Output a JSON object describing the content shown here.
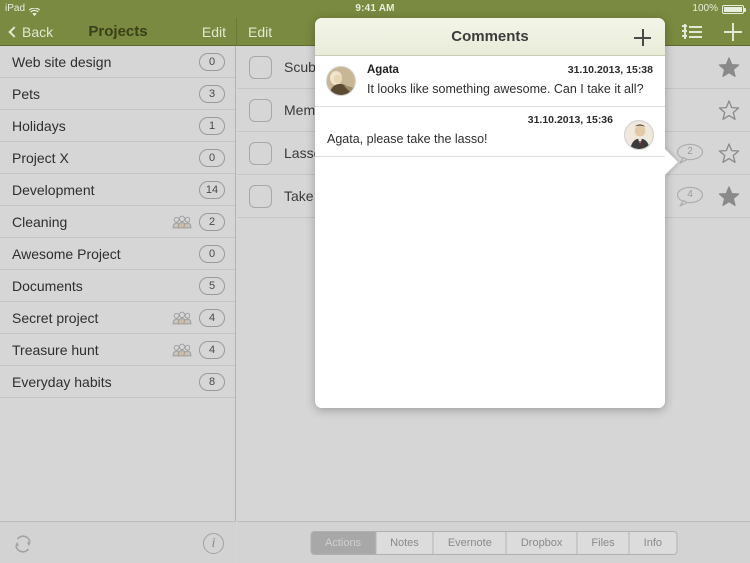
{
  "status_bar": {
    "device": "iPad",
    "wifi_icon": "wifi-icon",
    "time": "9:41 AM",
    "battery_percent": "100%"
  },
  "sidebar": {
    "nav": {
      "back_label": "Back",
      "title": "Projects",
      "edit_label": "Edit"
    },
    "projects": [
      {
        "name": "Web site design",
        "count": "0",
        "shared": false
      },
      {
        "name": "Pets",
        "count": "3",
        "shared": false
      },
      {
        "name": "Holidays",
        "count": "1",
        "shared": false
      },
      {
        "name": "Project X",
        "count": "0",
        "shared": false
      },
      {
        "name": "Development",
        "count": "14",
        "shared": false
      },
      {
        "name": "Cleaning",
        "count": "2",
        "shared": true
      },
      {
        "name": "Awesome Project",
        "count": "0",
        "shared": false
      },
      {
        "name": "Documents",
        "count": "5",
        "shared": false
      },
      {
        "name": "Secret project",
        "count": "4",
        "shared": true
      },
      {
        "name": "Treasure hunt",
        "count": "4",
        "shared": true
      },
      {
        "name": "Everyday habits",
        "count": "8",
        "shared": false
      }
    ],
    "toolbar": {
      "sync_icon": "sync-icon",
      "info_icon": "info-icon",
      "info_label": "i"
    }
  },
  "main": {
    "nav": {
      "edit_label": "Edit",
      "list_icon": "add-list-icon",
      "add_icon": "plus-icon"
    },
    "tasks": [
      {
        "name": "Scuba ",
        "starred": true,
        "comments": ""
      },
      {
        "name": "Memori",
        "starred": false,
        "comments": ""
      },
      {
        "name": "Lasso p",
        "starred": false,
        "comments": "2"
      },
      {
        "name": "Take ma",
        "starred": true,
        "comments": "4"
      }
    ],
    "bottom_tabs": [
      {
        "label": "Actions",
        "active": true
      },
      {
        "label": "Notes",
        "active": false
      },
      {
        "label": "Evernote",
        "active": false
      },
      {
        "label": "Dropbox",
        "active": false
      },
      {
        "label": "Files",
        "active": false
      },
      {
        "label": "Info",
        "active": false
      }
    ]
  },
  "comments_popover": {
    "title": "Comments",
    "add_icon": "plus-icon",
    "comments": [
      {
        "side": "them",
        "author": "Agata",
        "timestamp": "31.10.2013, 15:38",
        "text": "It looks like something awesome. Can I take it all?",
        "avatar": "avatar-agata"
      },
      {
        "side": "me",
        "author": "",
        "timestamp": "31.10.2013, 15:36",
        "text": "Agata, please take the lasso!",
        "avatar": "avatar-me"
      }
    ]
  },
  "colors": {
    "brand_green": "#7a8a40",
    "background_gray": "#d6d6d6",
    "popover_header": "#eef1e0"
  }
}
